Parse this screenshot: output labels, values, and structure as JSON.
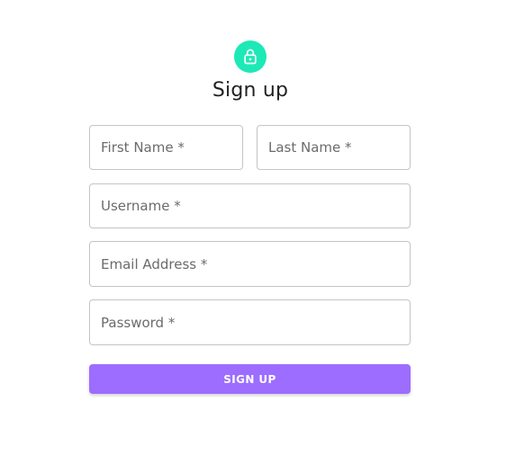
{
  "colors": {
    "avatar_bg": "#1de9b6",
    "button_bg": "#9c6dff",
    "lock_icon": "lock-outline-icon"
  },
  "header": {
    "title": "Sign up"
  },
  "form": {
    "first_name_placeholder": "First Name *",
    "last_name_placeholder": "Last Name *",
    "username_placeholder": "Username *",
    "email_placeholder": "Email Address *",
    "password_placeholder": "Password *",
    "submit_label": "SIGN UP"
  }
}
